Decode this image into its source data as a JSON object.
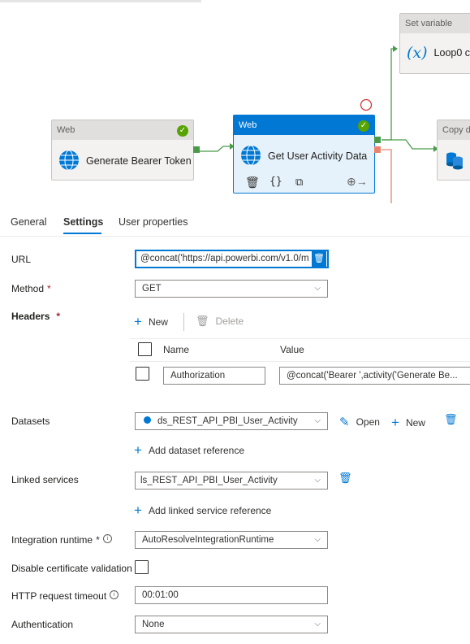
{
  "canvas": {
    "nodes": {
      "set_variable": {
        "type": "Set variable",
        "title": "Loop0 c"
      },
      "generate_token": {
        "type": "Web",
        "title": "Generate Bearer Token"
      },
      "get_activity": {
        "type": "Web",
        "title": "Get User Activity Data"
      },
      "copy_data": {
        "type": "Copy d"
      }
    }
  },
  "tabs": [
    "General",
    "Settings",
    "User properties"
  ],
  "form": {
    "url": {
      "label": "URL",
      "value": "@concat('https://api.powerbi.com/v1.0/m"
    },
    "method": {
      "label": "Method",
      "required": "*",
      "value": "GET"
    },
    "headers": {
      "label": "Headers",
      "required": "*",
      "new_label": "New",
      "delete_label": "Delete",
      "col_name": "Name",
      "col_value": "Value",
      "rows": [
        {
          "name": "Authorization",
          "value": "@concat('Bearer ',activity('Generate Be..."
        }
      ]
    },
    "datasets": {
      "label": "Datasets",
      "value": "ds_REST_API_PBI_User_Activity",
      "open_label": "Open",
      "new_label": "New",
      "add_label": "Add dataset reference"
    },
    "linked_services": {
      "label": "Linked services",
      "value": "ls_REST_API_PBI_User_Activity",
      "add_label": "Add linked service reference"
    },
    "integration_runtime": {
      "label": "Integration runtime",
      "required": "*",
      "value": "AutoResolveIntegrationRuntime"
    },
    "disable_cert": {
      "label": "Disable certificate validation"
    },
    "http_timeout": {
      "label": "HTTP request timeout",
      "value": "00:01:00"
    },
    "authentication": {
      "label": "Authentication",
      "value": "None"
    }
  },
  "colors": {
    "accent": "#0078d4",
    "success": "#57a300",
    "error": "#d13438",
    "required": "#a4262c"
  },
  "icons": {
    "node_web": "globe-icon",
    "node_set_variable": "variable-icon",
    "node_copy": "database-icon",
    "node_status": "check-circle-icon",
    "node_delete": "trash-icon",
    "node_code": "braces-icon",
    "node_copy_action": "copy-icon",
    "node_output": "arrow-out-icon",
    "dataset": "dataset-icon",
    "edit": "pencil-icon",
    "add": "plus-icon",
    "info": "info-icon"
  }
}
